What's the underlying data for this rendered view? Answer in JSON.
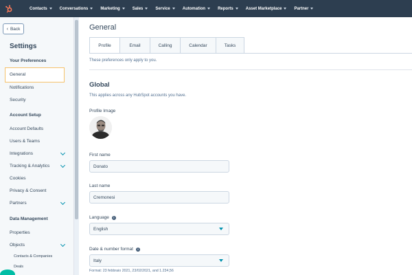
{
  "topnav": {
    "logo_icon": "hubspot-sprocket-icon",
    "items": [
      "Contacts",
      "Conversations",
      "Marketing",
      "Sales",
      "Service",
      "Automation",
      "Reports",
      "Asset Marketplace",
      "Partner"
    ],
    "bg": "#2d3e50",
    "logo_color": "#ff7a59"
  },
  "sidebar": {
    "back_label": "Back",
    "title": "Settings",
    "groups": {
      "your_preferences": "Your Preferences",
      "account_setup": "Account Setup",
      "data_management": "Data Management"
    },
    "items": {
      "general": "General",
      "notifications": "Notifications",
      "security": "Security",
      "account_defaults": "Account Defaults",
      "users_teams": "Users & Teams",
      "integrations": "Integrations",
      "tracking_analytics": "Tracking & Analytics",
      "cookies": "Cookies",
      "privacy_consent": "Privacy & Consent",
      "partners": "Partners",
      "properties": "Properties",
      "objects": "Objects",
      "contacts_companies": "Contacts & Companies",
      "deals": "Deals"
    },
    "active_item": "General",
    "highlight_color": "#f5c26b"
  },
  "main": {
    "title": "General",
    "tabs": [
      "Profile",
      "Email",
      "Calling",
      "Calendar",
      "Tasks"
    ],
    "active_tab": "Profile",
    "pref_note": "These preferences only apply to you.",
    "section_title": "Global",
    "section_sub": "This applies across any HubSpot accounts you have.",
    "profile_image_label": "Profile Image",
    "first_name_label": "First name",
    "first_name_value": "Donato",
    "last_name_label": "Last name",
    "last_name_value": "Cremonesi",
    "language_label": "Language",
    "language_value": "English",
    "date_format_label": "Date & number format",
    "date_format_value": "Italy",
    "format_note": "Format: 23 febbraio 2021, 23/02/2021, and 1.234,56",
    "accent_color": "#0091ae"
  }
}
